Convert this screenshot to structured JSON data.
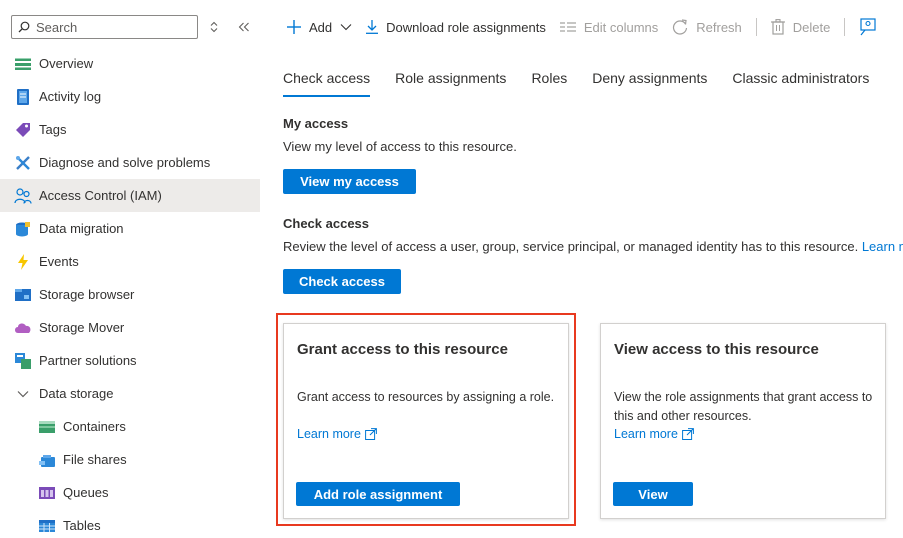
{
  "sidebar": {
    "search_placeholder": "Search",
    "items": [
      {
        "label": "Overview",
        "icon": "overview-icon"
      },
      {
        "label": "Activity log",
        "icon": "activity-log-icon"
      },
      {
        "label": "Tags",
        "icon": "tag-icon"
      },
      {
        "label": "Diagnose and solve problems",
        "icon": "wrench-icon"
      },
      {
        "label": "Access Control (IAM)",
        "icon": "people-icon"
      },
      {
        "label": "Data migration",
        "icon": "data-migration-icon"
      },
      {
        "label": "Events",
        "icon": "lightning-icon"
      },
      {
        "label": "Storage browser",
        "icon": "storage-browser-icon"
      },
      {
        "label": "Storage Mover",
        "icon": "cloud-icon"
      },
      {
        "label": "Partner solutions",
        "icon": "partner-icon"
      },
      {
        "label": "Data storage",
        "icon": "chevron-down-icon"
      },
      {
        "label": "Containers",
        "icon": "containers-icon"
      },
      {
        "label": "File shares",
        "icon": "file-shares-icon"
      },
      {
        "label": "Queues",
        "icon": "queues-icon"
      },
      {
        "label": "Tables",
        "icon": "tables-icon"
      }
    ]
  },
  "toolbar": {
    "add": "Add",
    "download": "Download role assignments",
    "edit_columns": "Edit columns",
    "refresh": "Refresh",
    "delete": "Delete"
  },
  "tabs": [
    "Check access",
    "Role assignments",
    "Roles",
    "Deny assignments",
    "Classic administrators"
  ],
  "my_access": {
    "title": "My access",
    "text": "View my level of access to this resource.",
    "button": "View my access"
  },
  "check_access": {
    "title": "Check access",
    "text": "Review the level of access a user, group, service principal, or managed identity has to this resource.",
    "link": "Learn mo",
    "button": "Check access"
  },
  "cards": [
    {
      "title": "Grant access to this resource",
      "desc": "Grant access to resources by assigning a role.",
      "link": "Learn more",
      "button": "Add role assignment"
    },
    {
      "title": "View access to this resource",
      "desc": "View the role assignments that grant access to this and other resources.",
      "link": "Learn more",
      "button": "View"
    }
  ],
  "colors": {
    "accent": "#0078d4",
    "highlight": "#e8391f"
  }
}
